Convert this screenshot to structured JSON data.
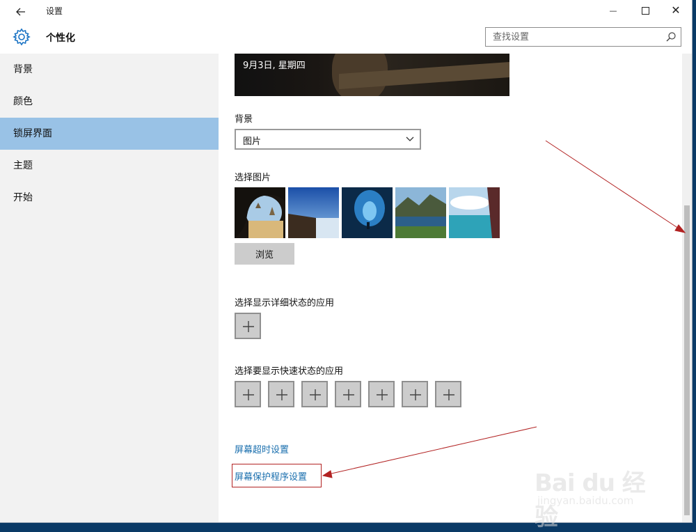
{
  "window": {
    "app_title": "设置",
    "minimize_symbol": "—",
    "close_symbol": "✕"
  },
  "header": {
    "page_title": "个性化",
    "search_placeholder": "查找设置"
  },
  "sidebar": {
    "items": [
      {
        "label": "背景"
      },
      {
        "label": "颜色"
      },
      {
        "label": "锁屏界面"
      },
      {
        "label": "主题"
      },
      {
        "label": "开始"
      }
    ],
    "selected_index": 2
  },
  "content": {
    "preview_date": "9月3日, 星期四",
    "background_label": "背景",
    "background_value": "图片",
    "choose_picture_label": "选择图片",
    "browse_label": "浏览",
    "detailed_status_label": "选择显示详细状态的应用",
    "quick_status_label": "选择要显示快速状态的应用",
    "quick_status_slots": 7,
    "screen_timeout_link": "屏幕超时设置",
    "screensaver_link": "屏幕保护程序设置"
  },
  "colors": {
    "selected_nav": "#99c2e6",
    "link": "#1a6fae",
    "annotation": "#b22222"
  },
  "watermark": {
    "brand": "Bai du 经验",
    "url": "jingyan.baidu.com"
  }
}
